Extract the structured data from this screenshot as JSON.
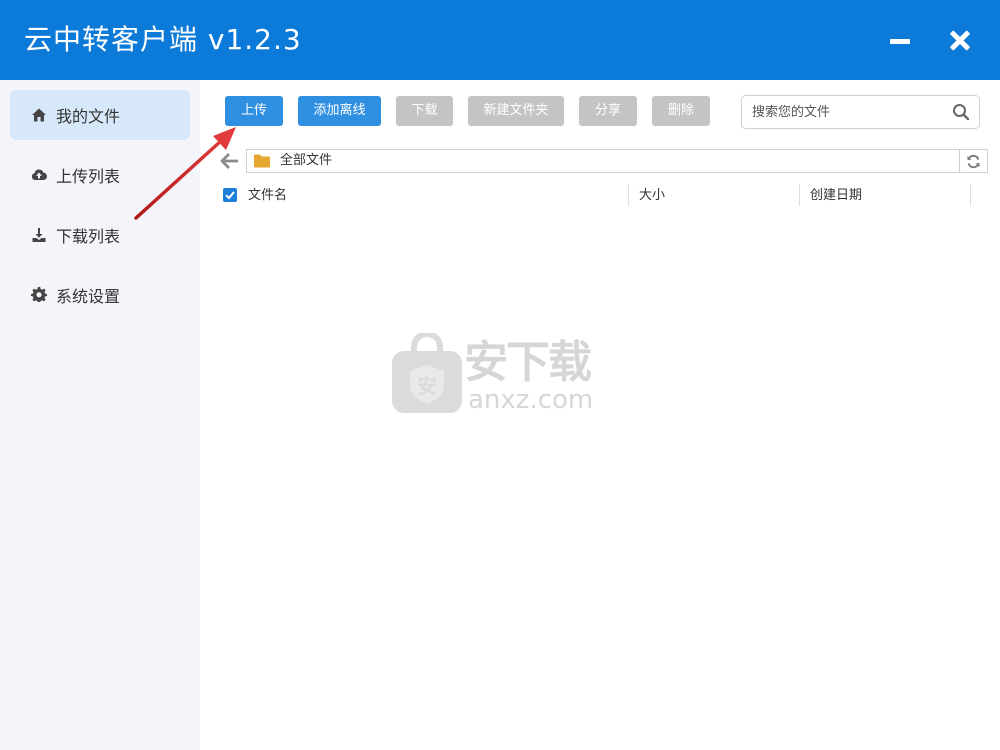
{
  "app": {
    "title": "云中转客户端 v1.2.3",
    "accent_color": "#0c7ad9"
  },
  "window_controls": {
    "minimize_icon": "minimize-icon",
    "close_icon": "close-icon"
  },
  "sidebar": {
    "items": [
      {
        "label": "我的文件",
        "icon": "home-icon",
        "active": true
      },
      {
        "label": "上传列表",
        "icon": "cloud-upload-icon",
        "active": false
      },
      {
        "label": "下载列表",
        "icon": "download-icon",
        "active": false
      },
      {
        "label": "系统设置",
        "icon": "gear-icon",
        "active": false
      }
    ]
  },
  "toolbar": {
    "upload": "上传",
    "add_offline": "添加离线",
    "download": "下载",
    "new_folder": "新建文件夹",
    "share": "分享",
    "delete": "删除",
    "primary_color": "#2f8fe0",
    "disabled_color": "#c4c4c4"
  },
  "search": {
    "placeholder": "搜索您的文件",
    "value": ""
  },
  "path": {
    "current": "全部文件"
  },
  "table": {
    "columns": [
      "文件名",
      "大小",
      "创建日期"
    ],
    "select_all_checked": true,
    "rows": []
  },
  "watermark": {
    "cn": "安下载",
    "en": "anxz.com",
    "badge": "安"
  }
}
